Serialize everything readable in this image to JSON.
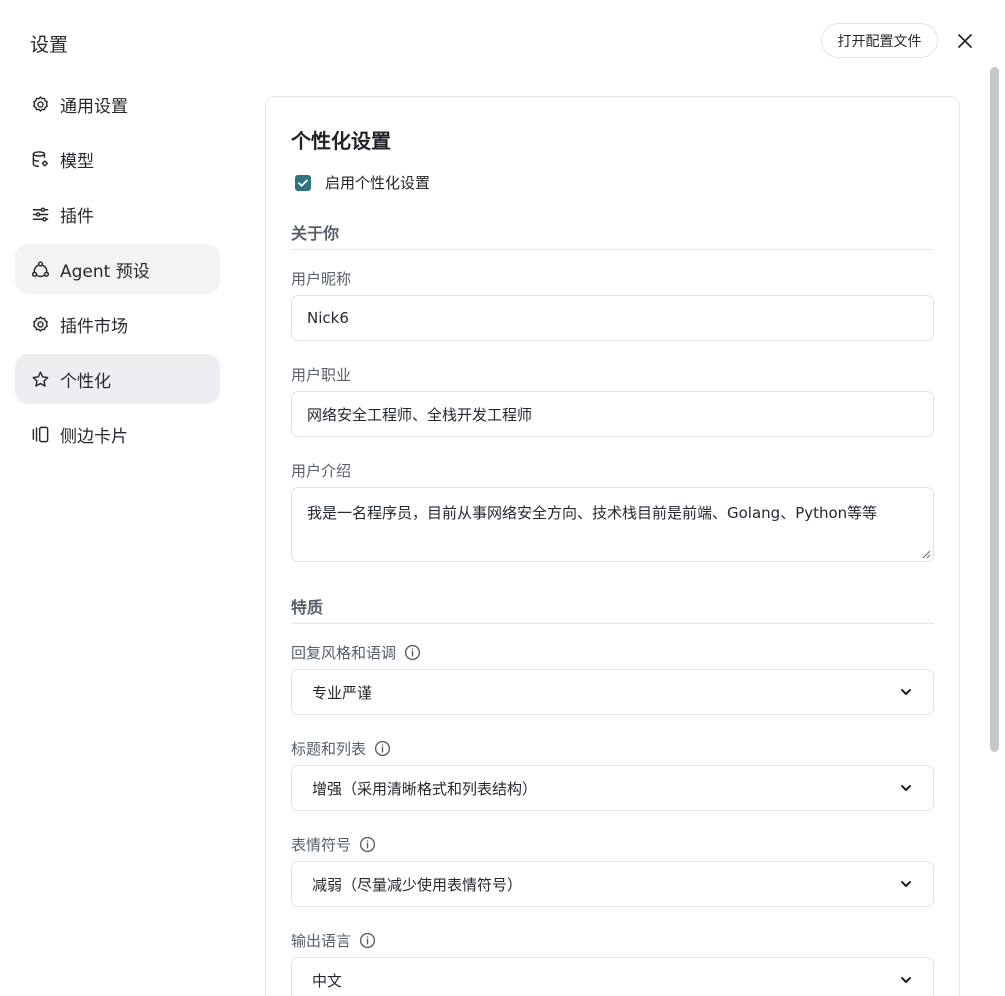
{
  "window": {
    "title": "设置",
    "open_config_label": "打开配置文件"
  },
  "sidebar": {
    "items": [
      {
        "label": "通用设置",
        "icon": "gear-icon"
      },
      {
        "label": "模型",
        "icon": "database-icon"
      },
      {
        "label": "插件",
        "icon": "sliders-icon"
      },
      {
        "label": "Agent 预设",
        "icon": "share-nodes-icon"
      },
      {
        "label": "插件市场",
        "icon": "gear-icon"
      },
      {
        "label": "个性化",
        "icon": "star-icon"
      },
      {
        "label": "侧边卡片",
        "icon": "cards-icon"
      }
    ],
    "active_index": 5
  },
  "personalization": {
    "title": "个性化设置",
    "enable_label": "启用个性化设置",
    "enabled": true,
    "about_section": "关于你",
    "nickname_label": "用户昵称",
    "nickname_value": "Nick6",
    "job_label": "用户职业",
    "job_value": "网络安全工程师、全栈开发工程师",
    "intro_label": "用户介绍",
    "intro_value": "我是一名程序员，目前从事网络安全方向、技术栈目前是前端、Golang、Python等等",
    "traits_section": "特质",
    "style_label": "回复风格和语调",
    "style_value": "专业严谨",
    "headings_label": "标题和列表",
    "headings_value": "增强（采用清晰格式和列表结构）",
    "emoji_label": "表情符号",
    "emoji_value": "减弱（尽量减少使用表情符号）",
    "language_label": "输出语言",
    "language_value": "中文"
  },
  "colors": {
    "accent": "#2f7282",
    "border": "#dfe3e8",
    "active_nav_bg": "#eceef1"
  }
}
